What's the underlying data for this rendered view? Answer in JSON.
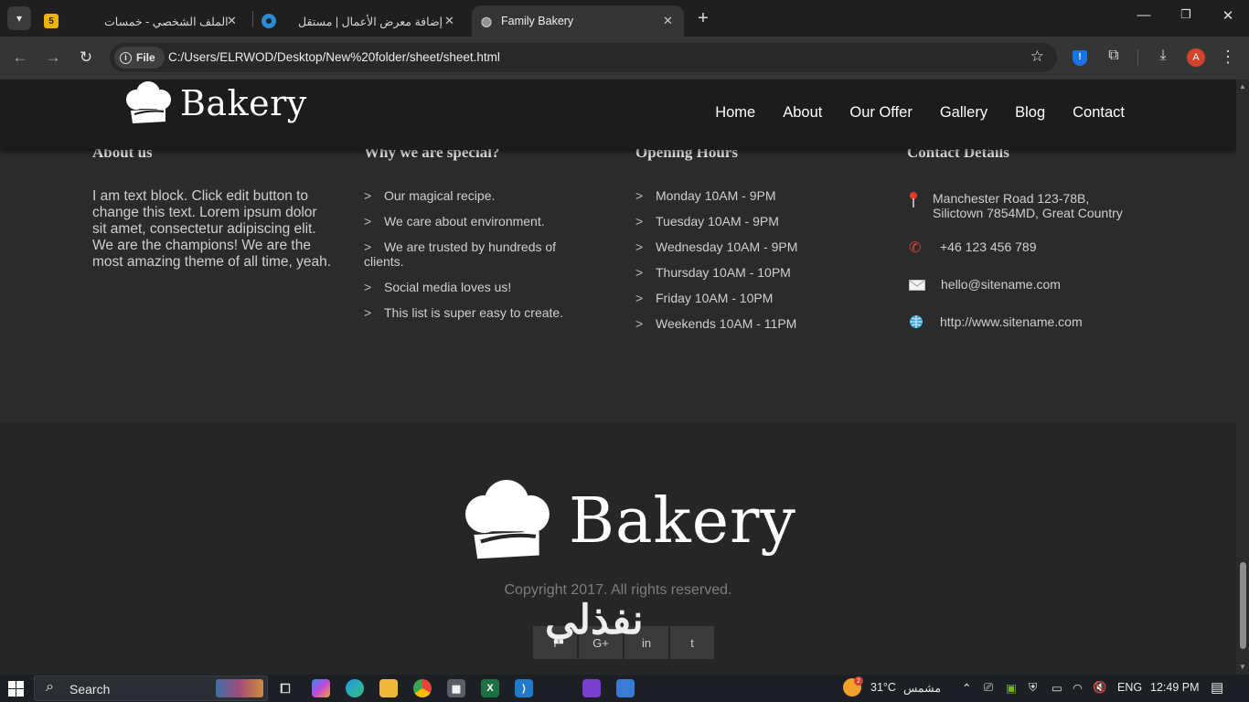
{
  "browser": {
    "tabs": [
      {
        "title": "الملف الشخصي - خمسات",
        "favicon": "5"
      },
      {
        "title": "إضافة معرض الأعمال | مستقل",
        "favicon": ""
      },
      {
        "title": "Family Bakery",
        "favicon": ""
      }
    ],
    "new_tab": "+",
    "url_chip": "File",
    "url": "C:/Users/ELRWOD/Desktop/New%20folder/sheet/sheet.html",
    "avatar_letter": "A",
    "shield_letter": "!"
  },
  "site": {
    "logo_text": "Bakery",
    "nav": [
      "Home",
      "About",
      "Our Offer",
      "Gallery",
      "Blog",
      "Contact"
    ],
    "about": {
      "title": "About us",
      "text": "I am text block. Click edit button to change this text. Lorem ipsum dolor sit amet, consectetur adipiscing elit. We are the champions! We are the most amazing theme of all time, yeah."
    },
    "special": {
      "title": "Why we are special?",
      "items": [
        "Our magical recipe.",
        "We care about environment.",
        "We are trusted by hundreds of clients.",
        "Social media loves us!",
        "This list is super easy to create."
      ]
    },
    "hours": {
      "title": "Opening Hours",
      "items": [
        "Monday 10AM - 9PM",
        "Tuesday 10AM - 9PM",
        "Wednesday 10AM - 9PM",
        "Thursday 10AM - 10PM",
        "Friday 10AM - 10PM",
        "Weekends 10AM - 11PM"
      ]
    },
    "contact": {
      "title": "Contact Details",
      "address_line1": "Manchester Road 123-78B,",
      "address_line2": "Silictown 7854MD, Great Country",
      "phone": "+46 123 456 789",
      "email": "hello@sitename.com",
      "website": "http://www.sitename.com"
    },
    "footer": {
      "logo_text": "Bakery",
      "copyright": "Copyright 2017. All rights reserved.",
      "socials": [
        "f",
        "G+",
        "in",
        "t"
      ],
      "watermark": "نفذلي"
    }
  },
  "taskbar": {
    "search_label": "Search",
    "temperature": "31°C",
    "weather": "مشمس",
    "weather_badge": "2",
    "language": "ENG",
    "time": "12:49 PM"
  },
  "colors": {
    "page_bg": "#2b2b2b",
    "header_bg": "#1c1c1c",
    "footer_bg": "#262626",
    "browser_accent": "#1a73e8",
    "avatar": "#d2432b"
  }
}
